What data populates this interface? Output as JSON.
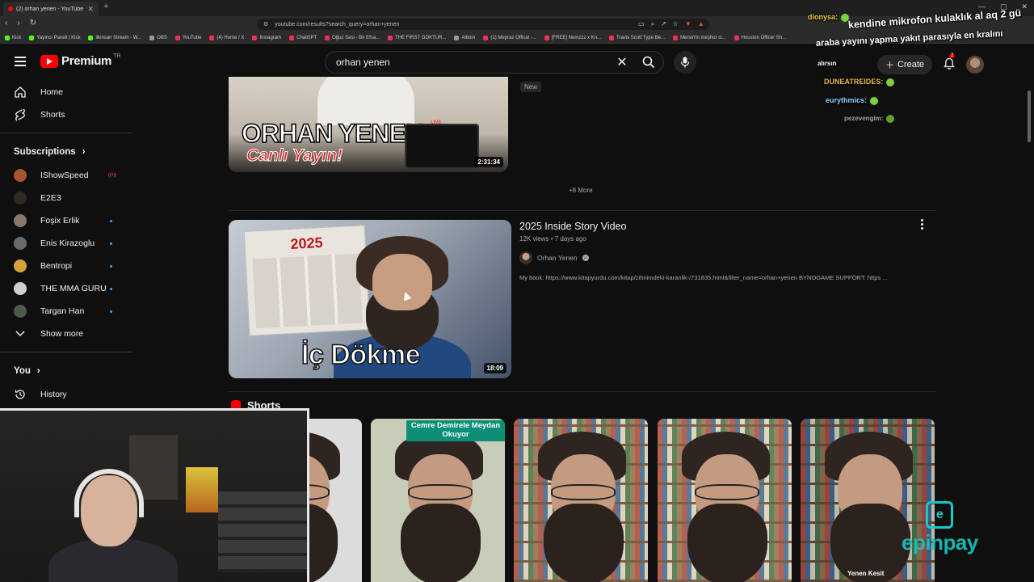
{
  "browser": {
    "tab_title": "(2) orhan yenen - YouTube",
    "url": "youtube.com/results?search_query=orhan+yenen",
    "bookmarks": [
      "Kick",
      "Yayıncı Paneli | Kick",
      "ilkinsan Stream - W...",
      "OBS",
      "YouTube",
      "(4) Home / X",
      "Instagram",
      "ChatGPT",
      "Oğuz Sasi - Bir Efsa...",
      "THE FIRST GOKTUR...",
      "Albüm",
      "(1) Mepraz Offical -...",
      "[FREE] Nemzzz x Kn...",
      "Travis Scott Type Be...",
      "Mersin'in meşhur ci...",
      "Houston Officer Sh..."
    ]
  },
  "header": {
    "logo": "Premium",
    "region": "TR",
    "search_query": "orhan yenen",
    "create_label": "Create",
    "notification_count": "2"
  },
  "sidebar": {
    "nav": [
      {
        "label": "Home",
        "icon": "home-icon"
      },
      {
        "label": "Shorts",
        "icon": "shorts-icon"
      }
    ],
    "subscriptions_label": "Subscriptions",
    "subscriptions": [
      {
        "label": "IShowSpeed",
        "status": "live",
        "color": "#a8552f"
      },
      {
        "label": "E2E3",
        "status": "",
        "color": "#2d2a1e"
      },
      {
        "label": "Foşix Erlik",
        "status": "new",
        "color": "#8a7766"
      },
      {
        "label": "Enis Kirazoglu",
        "status": "new",
        "color": "#6b6b6b"
      },
      {
        "label": "Bentropi",
        "status": "new",
        "color": "#d8a23a"
      },
      {
        "label": "THE MMA GURU",
        "status": "new",
        "color": "#cfcfcf"
      },
      {
        "label": "Targan Han",
        "status": "new",
        "color": "#4d5b4a"
      }
    ],
    "show_more": "Show more",
    "you_label": "You",
    "history_label": "History"
  },
  "results": {
    "top_video": {
      "thumb_title": "ORHAN YENEN",
      "thumb_subtitle": "Canlı Yayın!",
      "thumb_live": "LIVE",
      "duration": "2:31:34",
      "badge": "New"
    },
    "more_label": "+8 More",
    "video": {
      "title": "2025 Inside Story Video",
      "views": "12K views",
      "age": "7 days ago",
      "channel": "Orhan Yenen",
      "description": "My book: https://www.kitapyurdu.com/kitap/zihnimdeki-karanlik-/731835.html&filter_name=orhan+yenen BYNOGAME SUPPORT: https ...",
      "thumb_year": "2025",
      "thumb_text": "İç Dökme",
      "duration": "18:09"
    },
    "shorts_label": "Shorts",
    "shorts": [
      {
        "caption": "",
        "watermark": ""
      },
      {
        "caption": "Cemre Demirele Meydan Okuyor",
        "watermark": ""
      },
      {
        "caption": "",
        "watermark": ""
      },
      {
        "caption": "",
        "watermark": ""
      },
      {
        "caption": "",
        "watermark": "Yenen Kesit"
      }
    ]
  },
  "overlay": {
    "chat": [
      {
        "user": "dionysa:",
        "text": ""
      },
      {
        "user": "",
        "text": "kendine mikrofon kulaklık al aq 2 gü"
      },
      {
        "user": "",
        "text": "araba yayını yapma yakıt parasıyla en kralını"
      },
      {
        "user": "",
        "text": "alırsın"
      },
      {
        "user": "DUNEATREIDES:",
        "text": ""
      },
      {
        "user": "eurythmics:",
        "text": ""
      },
      {
        "user": "pezevengim:",
        "text": ""
      }
    ],
    "sponsor": "epinpay"
  }
}
